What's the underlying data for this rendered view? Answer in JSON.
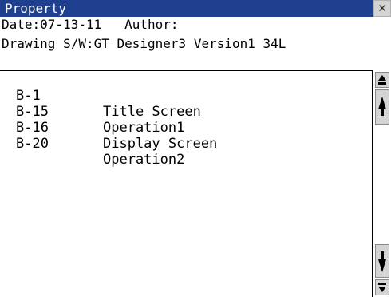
{
  "window": {
    "title": "Property",
    "close_glyph": "✕"
  },
  "info": {
    "line1": "Date:07-13-11   Author:",
    "line2": "Drawing S/W:GT Designer3 Version1 34L"
  },
  "screens": [
    {
      "code": "B-1",
      "name": "Title Screen"
    },
    {
      "code": "B-15",
      "name": "Operation1"
    },
    {
      "code": "B-16",
      "name": "Display Screen"
    },
    {
      "code": "B-20",
      "name": "Operation2"
    }
  ],
  "scrollbar": {
    "buttons": [
      "scroll-top-icon",
      "scroll-up-icon",
      "scroll-down-icon",
      "scroll-bottom-icon"
    ]
  },
  "colors": {
    "title_bg": "#1f3f8f",
    "title_text": "#ffffff",
    "button_face": "#d4d4d4"
  }
}
